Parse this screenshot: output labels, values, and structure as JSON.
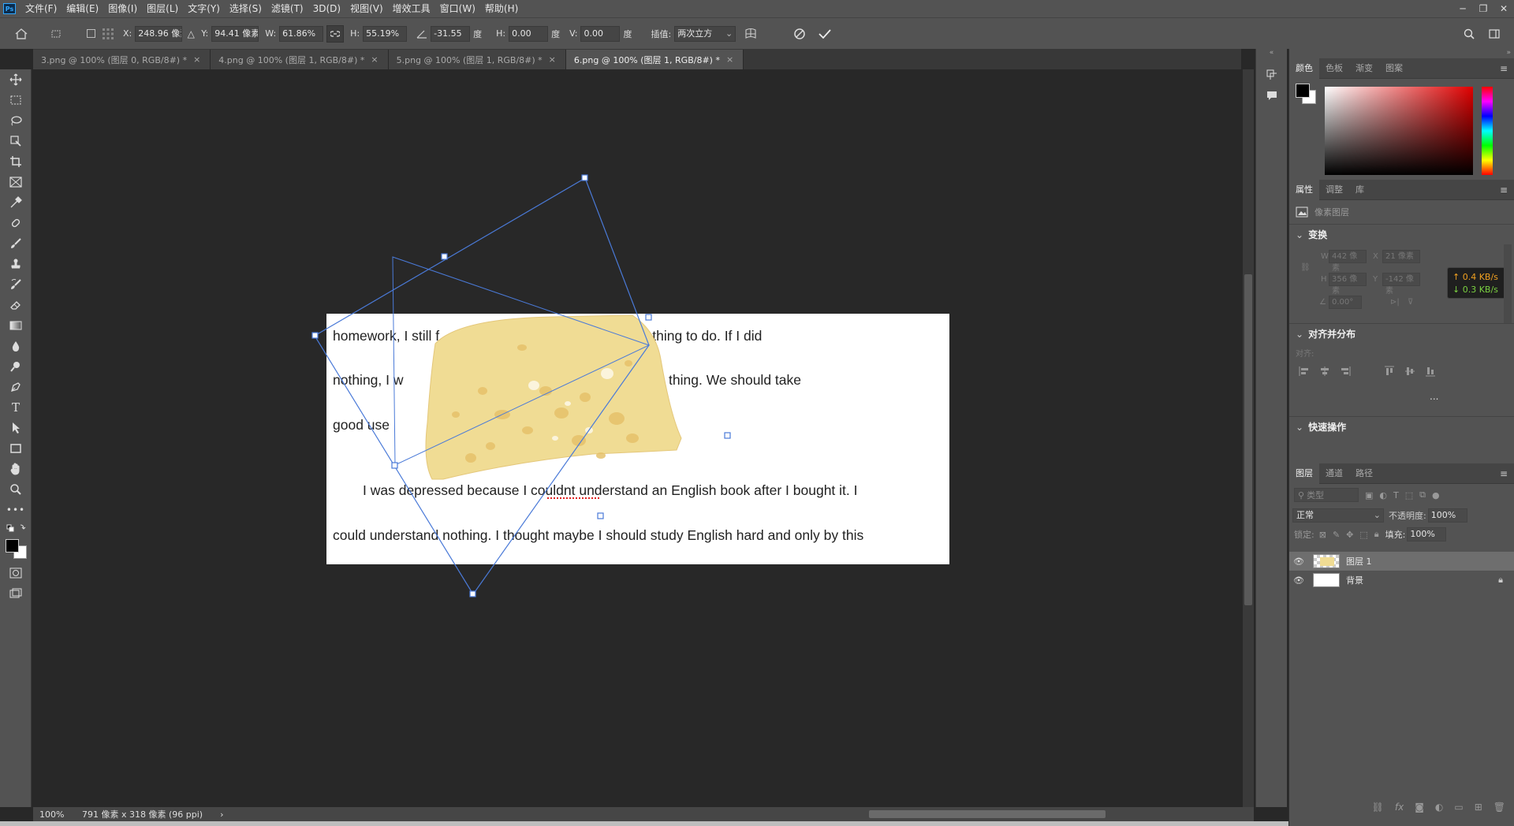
{
  "app": {
    "logo": "Ps"
  },
  "menu": [
    "文件(F)",
    "编辑(E)",
    "图像(I)",
    "图层(L)",
    "文字(Y)",
    "选择(S)",
    "滤镜(T)",
    "3D(D)",
    "视图(V)",
    "增效工具",
    "窗口(W)",
    "帮助(H)"
  ],
  "options": {
    "x_label": "X:",
    "x_value": "248.96 像素",
    "y_label": "Y:",
    "y_value": "94.41 像素",
    "w_label": "W:",
    "w_value": "61.86%",
    "h_label": "H:",
    "h_value": "55.19%",
    "angle_value": "-31.55",
    "angle_unit": "度",
    "hskew_label": "H:",
    "hskew_value": "0.00",
    "hskew_unit": "度",
    "vskew_label": "V:",
    "vskew_value": "0.00",
    "vskew_unit": "度",
    "interp_label": "插值:",
    "interp_value": "两次立方"
  },
  "tabs": [
    {
      "label": "3.png @ 100% (图层 0, RGB/8#) *",
      "close": "×"
    },
    {
      "label": "4.png @ 100% (图层 1, RGB/8#) *",
      "close": "×"
    },
    {
      "label": "5.png @ 100% (图层 1, RGB/8#) *",
      "close": "×"
    },
    {
      "label": "6.png @ 100% (图层 1, RGB/8#) *",
      "close": "×"
    }
  ],
  "document": {
    "line1": "homework, I still f                                office, I had nothing to do. If I did",
    "line2": "nothing, I w                  y  e                       do the foolish thing. We should take",
    "line3": "good use",
    "line4": "I was depressed because I couldnt understand an English book after I bought it. I",
    "line5": "could understand nothing. I thought maybe I should study English hard and only by this"
  },
  "status": {
    "zoom": "100%",
    "doc_info": "791 像素 x 318 像素 (96 ppi)",
    "arrow": "›"
  },
  "panels": {
    "color_tabs": [
      "颜色",
      "色板",
      "渐变",
      "图案"
    ],
    "props_tabs": [
      "属性",
      "调整",
      "库"
    ],
    "pixel_layer": "像素图层",
    "transform": "变换",
    "w_label": "W",
    "w_value": "442 像素",
    "x_label": "X",
    "x_value": "21 像素",
    "h_label": "H",
    "h_value": "356 像素",
    "y_label": "Y",
    "y_value": "-142 像素",
    "angle_value": "0.00°",
    "align_section": "对齐并分布",
    "align_label": "对齐:",
    "more": "...",
    "quick_actions": "快速操作",
    "net_up": "↑ 0.4 KB/s",
    "net_down": "↓ 0.3 KB/s",
    "layers_tabs": [
      "图层",
      "通道",
      "路径"
    ],
    "kind_placeholder": "类型",
    "blend_mode": "正常",
    "opacity_label": "不透明度:",
    "opacity_value": "100%",
    "lock_label": "锁定:",
    "fill_label": "填充:",
    "fill_value": "100%",
    "layers": [
      {
        "name": "图层 1",
        "selected": true
      },
      {
        "name": "背景",
        "selected": false
      }
    ]
  },
  "colors": {
    "accent": "#31a8ff",
    "handle": "#4a7ad8",
    "cheese": "#f0dc94",
    "net_up": "#f0a020",
    "net_down": "#7ad040"
  }
}
